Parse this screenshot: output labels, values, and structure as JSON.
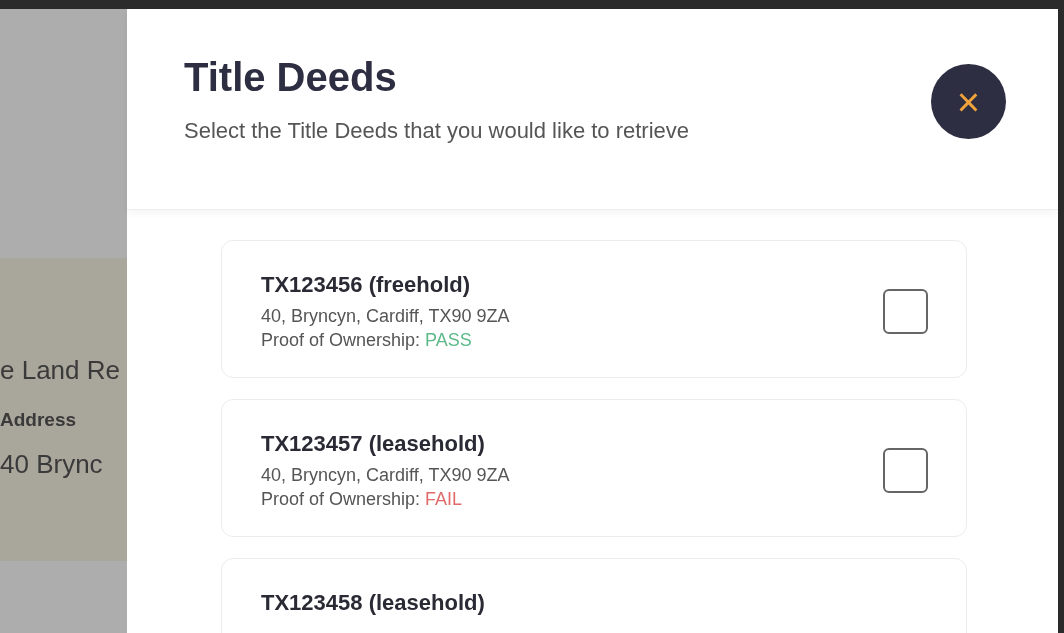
{
  "background": {
    "texts": [
      "e Land Re"
    ],
    "field_label": "Address",
    "field_value": "40 Brync"
  },
  "dialog": {
    "title": "Title Deeds",
    "subtitle": "Select the Title Deeds that you would like to retrieve",
    "close_icon": "×"
  },
  "deeds": [
    {
      "title": "TX123456 (freehold)",
      "address": "40, Bryncyn, Cardiff, TX90 9ZA",
      "proof_label": "Proof of Ownership:",
      "proof_result": "PASS",
      "kind": "pass",
      "checked": false
    },
    {
      "title": "TX123457 (leasehold)",
      "address": "40, Bryncyn, Cardiff, TX90 9ZA",
      "proof_label": "Proof of Ownership:",
      "proof_result": "FAIL",
      "kind": "fail",
      "checked": false
    },
    {
      "title": "TX123458 (leasehold)"
    }
  ]
}
